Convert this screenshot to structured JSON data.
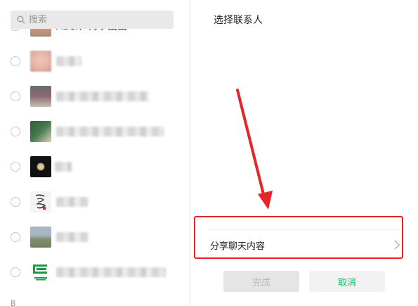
{
  "search": {
    "placeholder": "搜索"
  },
  "contacts": [
    {
      "name": "Abel、何季出出",
      "avatar_color": "#d8b8a0"
    },
    {
      "name": "",
      "avatar_color": "#e7b9a8"
    },
    {
      "name": "",
      "avatar_color": "#8b6a70"
    },
    {
      "name": "",
      "avatar_color": "#2f5a3a"
    },
    {
      "name": "",
      "avatar_color": "#111111"
    },
    {
      "name": "",
      "avatar_color": "#f0f0f0"
    },
    {
      "name": "",
      "avatar_color": "#7e8f6e"
    },
    {
      "name": "",
      "avatar_color": "#1b9a3f"
    }
  ],
  "section_letter": "B",
  "right": {
    "title": "选择联系人",
    "share_label": "分享聊天内容",
    "done_label": "完成",
    "cancel_label": "取消"
  },
  "colors": {
    "highlight": "#e8242a",
    "accent_green": "#07c160"
  }
}
